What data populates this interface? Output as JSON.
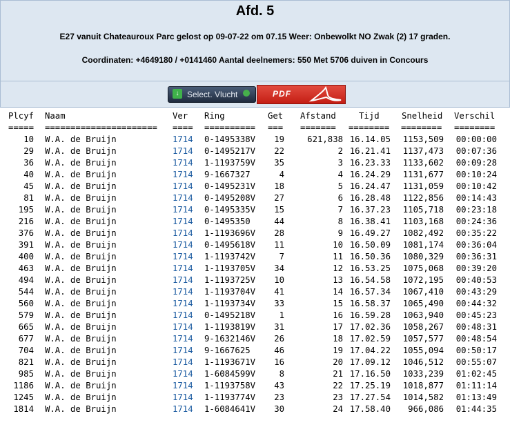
{
  "header": {
    "title": "Afd. 5",
    "line1": "E27 vanuit Chateauroux Parc gelost op 09-07-22 om 07.15 Weer: Onbewolkt NO Zwak (2) 17 graden.",
    "line2": "Coordinaten: +4649180 / +0141460 Aantal deelnemers: 550 Met 5706 duiven in Concours"
  },
  "toolbar": {
    "select_label": "Select. Vlucht",
    "pdf_label": "PDF"
  },
  "colors": {
    "header_bg": "#dde7f1",
    "link": "#1a5aa0",
    "pdf_red": "#d9261c"
  },
  "table": {
    "headers": {
      "plcyf": "Plcyf",
      "naam": "Naam",
      "ver": "Ver",
      "ring": "Ring",
      "get": "Get",
      "afstand": "Afstand",
      "tijd": "Tijd",
      "snelheid": "Snelheid",
      "verschil": "Verschil"
    },
    "separators": {
      "plcyf": "=====",
      "naam": "======================",
      "ver": "====",
      "ring": "==========",
      "get": "===",
      "afstand": "=======",
      "tijd": "========",
      "snelheid": "========",
      "verschil": "========"
    },
    "rows": [
      {
        "plcyf": "10",
        "naam": "W.A. de Bruijn",
        "ver": "1714",
        "ring": "0-1495338V",
        "get": "19",
        "afstand": "621,838",
        "tijd": "16.14.05",
        "snelheid": "1153,509",
        "verschil": "00:00:00"
      },
      {
        "plcyf": "29",
        "naam": "W.A. de Bruijn",
        "ver": "1714",
        "ring": "0-1495217V",
        "get": "22",
        "afstand": "2",
        "tijd": "16.21.41",
        "snelheid": "1137,473",
        "verschil": "00:07:36"
      },
      {
        "plcyf": "36",
        "naam": "W.A. de Bruijn",
        "ver": "1714",
        "ring": "1-1193759V",
        "get": "35",
        "afstand": "3",
        "tijd": "16.23.33",
        "snelheid": "1133,602",
        "verschil": "00:09:28"
      },
      {
        "plcyf": "40",
        "naam": "W.A. de Bruijn",
        "ver": "1714",
        "ring": "9-1667327",
        "get": "4",
        "afstand": "4",
        "tijd": "16.24.29",
        "snelheid": "1131,677",
        "verschil": "00:10:24"
      },
      {
        "plcyf": "45",
        "naam": "W.A. de Bruijn",
        "ver": "1714",
        "ring": "0-1495231V",
        "get": "18",
        "afstand": "5",
        "tijd": "16.24.47",
        "snelheid": "1131,059",
        "verschil": "00:10:42"
      },
      {
        "plcyf": "81",
        "naam": "W.A. de Bruijn",
        "ver": "1714",
        "ring": "0-1495208V",
        "get": "27",
        "afstand": "6",
        "tijd": "16.28.48",
        "snelheid": "1122,856",
        "verschil": "00:14:43"
      },
      {
        "plcyf": "195",
        "naam": "W.A. de Bruijn",
        "ver": "1714",
        "ring": "0-1495335V",
        "get": "15",
        "afstand": "7",
        "tijd": "16.37.23",
        "snelheid": "1105,718",
        "verschil": "00:23:18"
      },
      {
        "plcyf": "216",
        "naam": "W.A. de Bruijn",
        "ver": "1714",
        "ring": "0-1495350",
        "get": "44",
        "afstand": "8",
        "tijd": "16.38.41",
        "snelheid": "1103,168",
        "verschil": "00:24:36"
      },
      {
        "plcyf": "376",
        "naam": "W.A. de Bruijn",
        "ver": "1714",
        "ring": "1-1193696V",
        "get": "28",
        "afstand": "9",
        "tijd": "16.49.27",
        "snelheid": "1082,492",
        "verschil": "00:35:22"
      },
      {
        "plcyf": "391",
        "naam": "W.A. de Bruijn",
        "ver": "1714",
        "ring": "0-1495618V",
        "get": "11",
        "afstand": "10",
        "tijd": "16.50.09",
        "snelheid": "1081,174",
        "verschil": "00:36:04"
      },
      {
        "plcyf": "400",
        "naam": "W.A. de Bruijn",
        "ver": "1714",
        "ring": "1-1193742V",
        "get": "7",
        "afstand": "11",
        "tijd": "16.50.36",
        "snelheid": "1080,329",
        "verschil": "00:36:31"
      },
      {
        "plcyf": "463",
        "naam": "W.A. de Bruijn",
        "ver": "1714",
        "ring": "1-1193705V",
        "get": "34",
        "afstand": "12",
        "tijd": "16.53.25",
        "snelheid": "1075,068",
        "verschil": "00:39:20"
      },
      {
        "plcyf": "494",
        "naam": "W.A. de Bruijn",
        "ver": "1714",
        "ring": "1-1193725V",
        "get": "10",
        "afstand": "13",
        "tijd": "16.54.58",
        "snelheid": "1072,195",
        "verschil": "00:40:53"
      },
      {
        "plcyf": "544",
        "naam": "W.A. de Bruijn",
        "ver": "1714",
        "ring": "1-1193704V",
        "get": "41",
        "afstand": "14",
        "tijd": "16.57.34",
        "snelheid": "1067,410",
        "verschil": "00:43:29"
      },
      {
        "plcyf": "560",
        "naam": "W.A. de Bruijn",
        "ver": "1714",
        "ring": "1-1193734V",
        "get": "33",
        "afstand": "15",
        "tijd": "16.58.37",
        "snelheid": "1065,490",
        "verschil": "00:44:32"
      },
      {
        "plcyf": "579",
        "naam": "W.A. de Bruijn",
        "ver": "1714",
        "ring": "0-1495218V",
        "get": "1",
        "afstand": "16",
        "tijd": "16.59.28",
        "snelheid": "1063,940",
        "verschil": "00:45:23"
      },
      {
        "plcyf": "665",
        "naam": "W.A. de Bruijn",
        "ver": "1714",
        "ring": "1-1193819V",
        "get": "31",
        "afstand": "17",
        "tijd": "17.02.36",
        "snelheid": "1058,267",
        "verschil": "00:48:31"
      },
      {
        "plcyf": "677",
        "naam": "W.A. de Bruijn",
        "ver": "1714",
        "ring": "9-1632146V",
        "get": "26",
        "afstand": "18",
        "tijd": "17.02.59",
        "snelheid": "1057,577",
        "verschil": "00:48:54"
      },
      {
        "plcyf": "704",
        "naam": "W.A. de Bruijn",
        "ver": "1714",
        "ring": "9-1667625",
        "get": "46",
        "afstand": "19",
        "tijd": "17.04.22",
        "snelheid": "1055,094",
        "verschil": "00:50:17"
      },
      {
        "plcyf": "821",
        "naam": "W.A. de Bruijn",
        "ver": "1714",
        "ring": "1-1193671V",
        "get": "16",
        "afstand": "20",
        "tijd": "17.09.12",
        "snelheid": "1046,512",
        "verschil": "00:55:07"
      },
      {
        "plcyf": "985",
        "naam": "W.A. de Bruijn",
        "ver": "1714",
        "ring": "1-6084599V",
        "get": "8",
        "afstand": "21",
        "tijd": "17.16.50",
        "snelheid": "1033,239",
        "verschil": "01:02:45"
      },
      {
        "plcyf": "1186",
        "naam": "W.A. de Bruijn",
        "ver": "1714",
        "ring": "1-1193758V",
        "get": "43",
        "afstand": "22",
        "tijd": "17.25.19",
        "snelheid": "1018,877",
        "verschil": "01:11:14"
      },
      {
        "plcyf": "1245",
        "naam": "W.A. de Bruijn",
        "ver": "1714",
        "ring": "1-1193774V",
        "get": "23",
        "afstand": "23",
        "tijd": "17.27.54",
        "snelheid": "1014,582",
        "verschil": "01:13:49"
      },
      {
        "plcyf": "1814",
        "naam": "W.A. de Bruijn",
        "ver": "1714",
        "ring": "1-6084641V",
        "get": "30",
        "afstand": "24",
        "tijd": "17.58.40",
        "snelheid": "966,086",
        "verschil": "01:44:35"
      }
    ]
  }
}
